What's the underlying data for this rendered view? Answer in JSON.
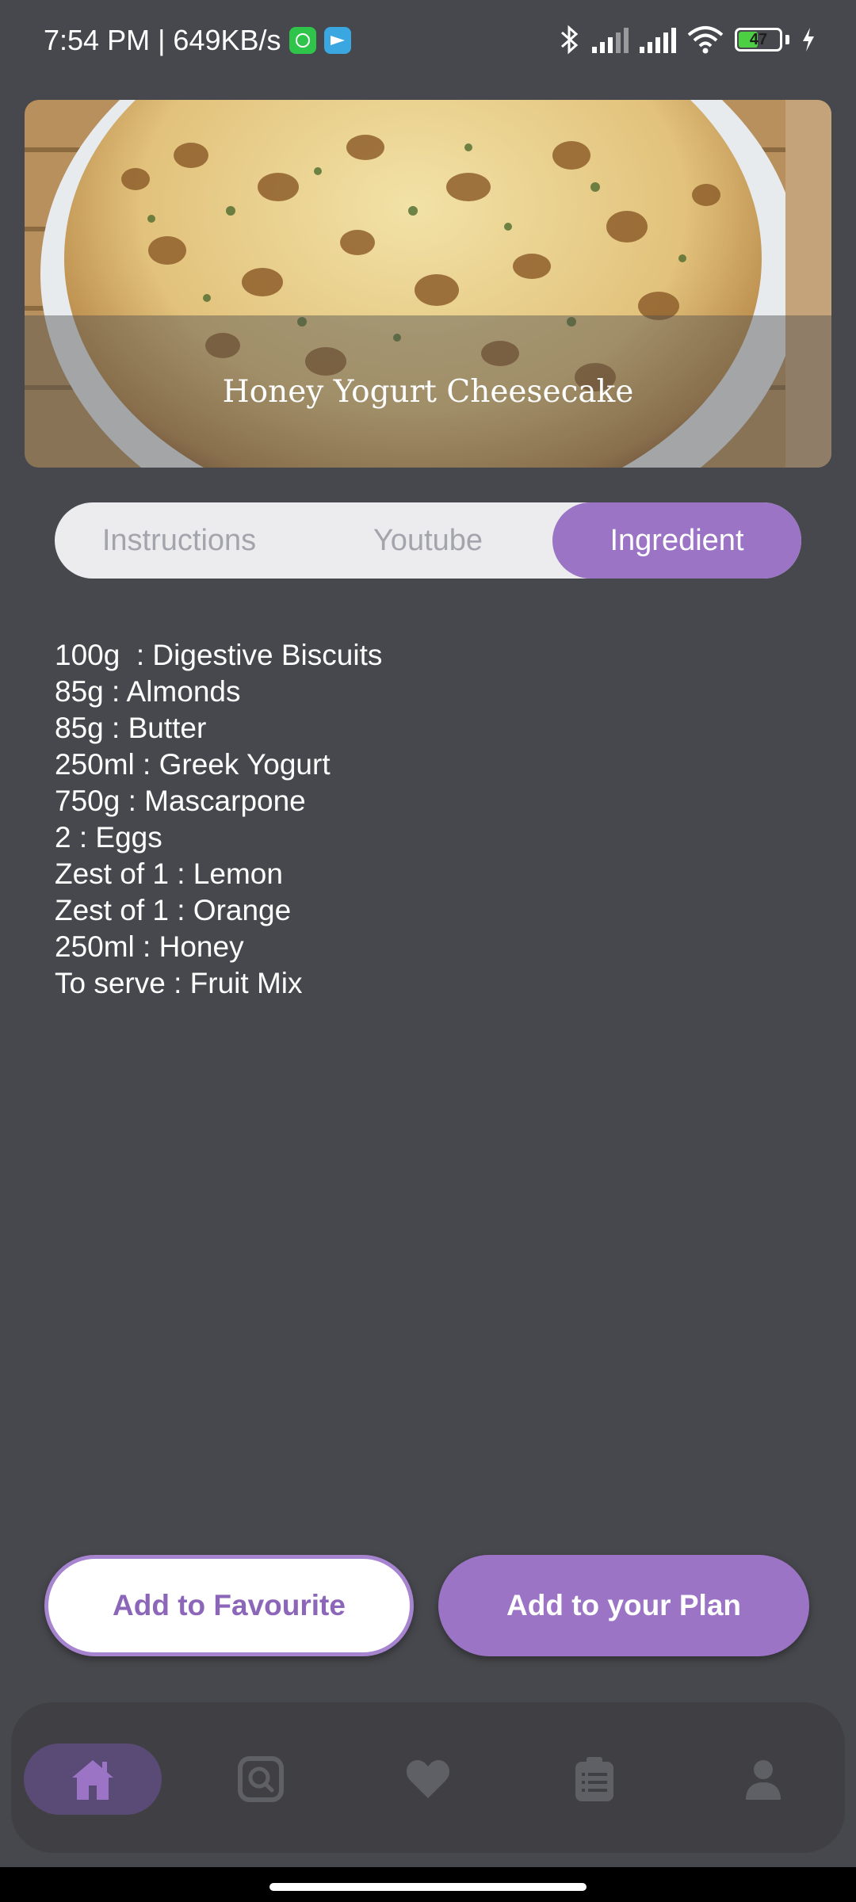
{
  "status_bar": {
    "time_speed": "7:54 PM | 649KB/s",
    "battery_level": "47",
    "battery_fraction": 0.47,
    "icons": [
      "whatsapp-icon",
      "telegram-icon",
      "bluetooth-icon",
      "signal-icon",
      "signal-icon",
      "wifi-icon",
      "battery-icon",
      "charging-icon"
    ]
  },
  "recipe": {
    "title": "Honey Yogurt Cheesecake"
  },
  "tabs": [
    {
      "label": "Instructions"
    },
    {
      "label": "Youtube"
    },
    {
      "label": "Ingredient"
    }
  ],
  "active_tab": "Ingredient",
  "ingredients": [
    "100g  : Digestive Biscuits",
    "85g : Almonds",
    "85g : Butter",
    "250ml : Greek Yogurt",
    "750g : Mascarpone",
    "2 : Eggs",
    "Zest of 1 : Lemon",
    "Zest of 1 : Orange",
    "250ml : Honey",
    "To serve : Fruit Mix"
  ],
  "actions": {
    "favourite_label": "Add to Favourite",
    "plan_label": "Add to your Plan"
  },
  "bottom_nav": {
    "items": [
      "home-icon",
      "search-icon",
      "heart-icon",
      "clipboard-list-icon",
      "profile-icon"
    ],
    "active": "home-icon"
  },
  "colors": {
    "accent": "#9b74c5",
    "background": "#47484d",
    "nav_background": "#404044",
    "tab_background": "#ececee",
    "inactive_icon": "#5f6065"
  }
}
